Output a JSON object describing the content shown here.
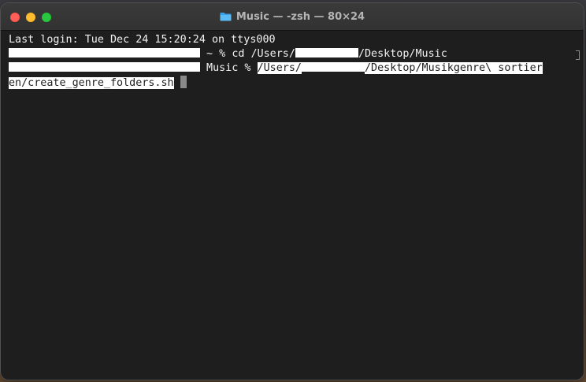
{
  "window": {
    "title": "Music — -zsh — 80×24",
    "folder_icon": "folder-icon",
    "colors": {
      "background": "#1e1e1e",
      "text": "#f2f2f2",
      "selection": "#ffffff",
      "close": "#ff5f57",
      "minimize": "#febc2e",
      "zoom": "#28c840"
    }
  },
  "terminal": {
    "last_login": "Last login: Tue Dec 24 15:20:24 on ttys000",
    "line2": {
      "prompt": " ~ % ",
      "command_prefix": "cd /Users/",
      "command_suffix": "/Desktop/Music"
    },
    "line3": {
      "prompt": " Music % ",
      "arg_prefix": "/Users/",
      "arg_suffix": "/Desktop/Musikgenre\\ sortier"
    },
    "line4": {
      "arg_continuation": "en/create_genre_folders.sh"
    }
  }
}
